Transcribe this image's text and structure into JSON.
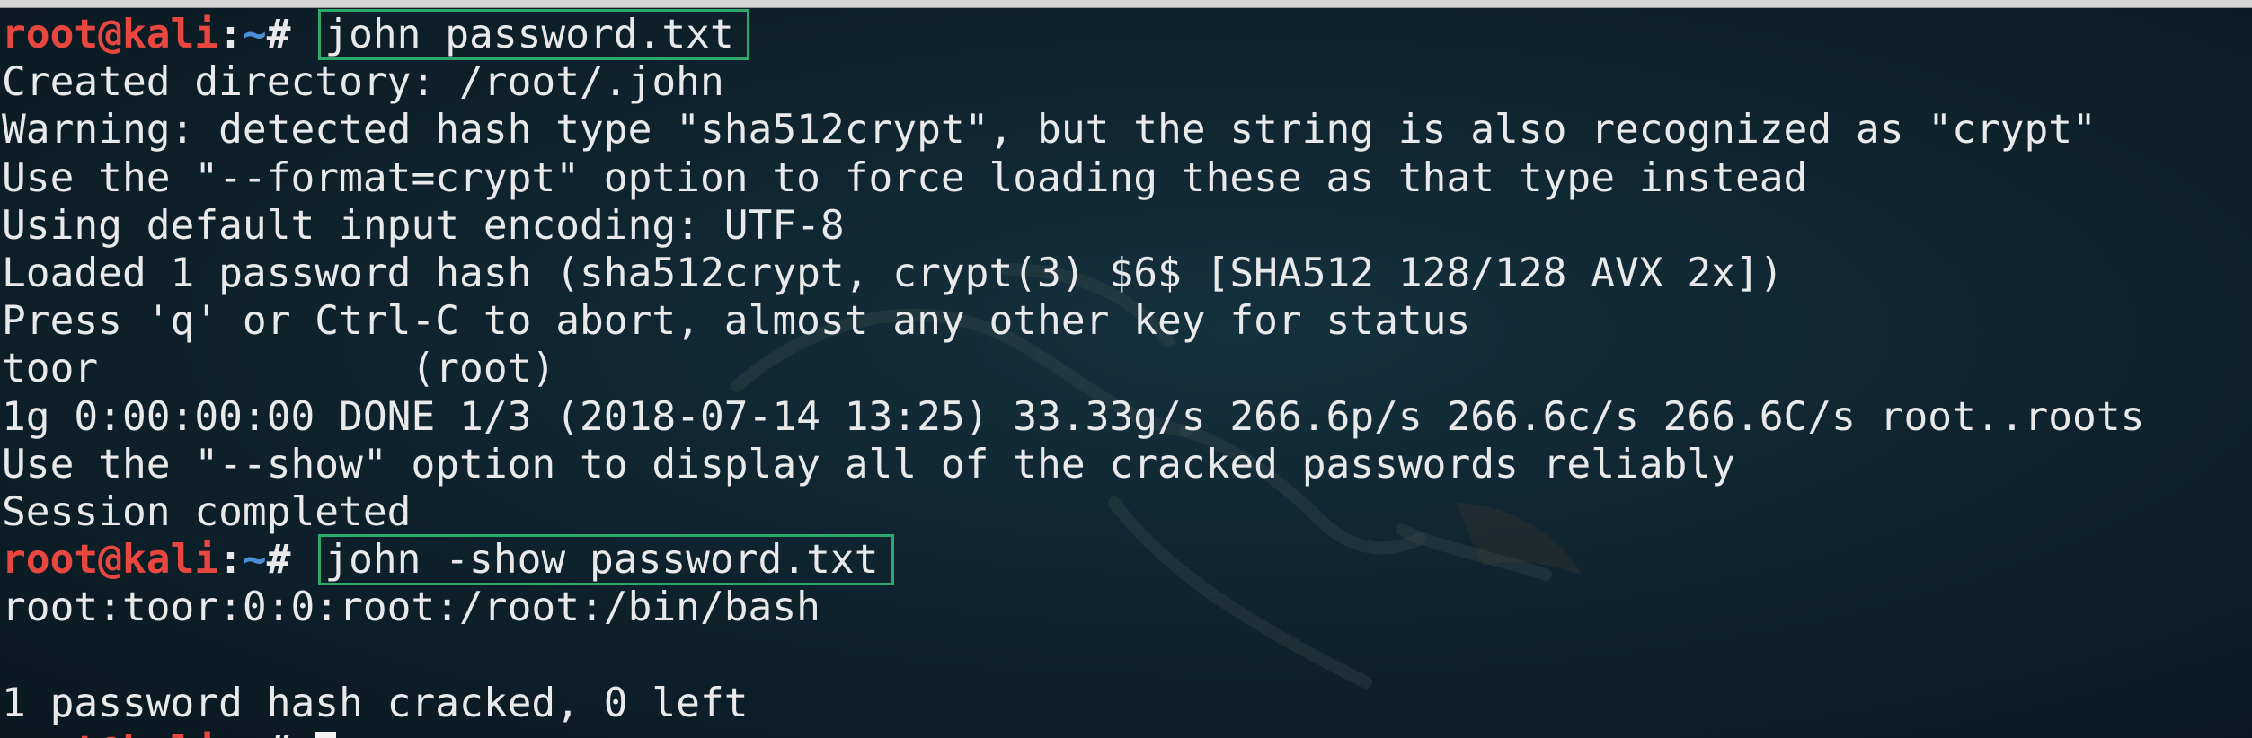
{
  "prompt": {
    "user_host": "root@kali",
    "path_sep": ":~# ",
    "path_colon": ":",
    "path_tilde": "~",
    "hash": "# "
  },
  "commands": [
    "john password.txt",
    "john -show password.txt"
  ],
  "output_1": [
    "Created directory: /root/.john",
    "Warning: detected hash type \"sha512crypt\", but the string is also recognized as \"crypt\"",
    "Use the \"--format=crypt\" option to force loading these as that type instead",
    "Using default input encoding: UTF-8",
    "Loaded 1 password hash (sha512crypt, crypt(3) $6$ [SHA512 128/128 AVX 2x])",
    "Press 'q' or Ctrl-C to abort, almost any other key for status",
    "toor             (root)",
    "1g 0:00:00:00 DONE 1/3 (2018-07-14 13:25) 33.33g/s 266.6p/s 266.6c/s 266.6C/s root..roots",
    "Use the \"--show\" option to display all of the cracked passwords reliably",
    "Session completed"
  ],
  "output_2": [
    "root:toor:0:0:root:/root:/bin/bash",
    "",
    "1 password hash cracked, 0 left"
  ],
  "colors": {
    "background": "#0f2530",
    "prompt_user": "#e8473f",
    "prompt_path": "#4b8fd8",
    "highlight_box": "#2ea86b",
    "text": "#e9e9e9"
  },
  "icons": {
    "watermark": "kali-dragon-logo"
  }
}
